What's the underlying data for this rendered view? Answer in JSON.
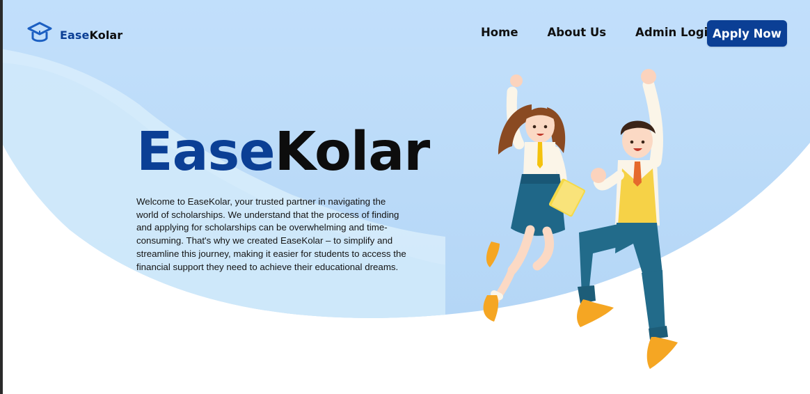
{
  "nav": {
    "logo_prefix": "Ease",
    "logo_suffix": "Kolar",
    "links": [
      {
        "label": "Home"
      },
      {
        "label": "About Us"
      },
      {
        "label": "Admin Login"
      }
    ],
    "cta_label": "Apply Now"
  },
  "hero": {
    "title_prefix": "Ease",
    "title_suffix": "Kolar",
    "description": "Welcome to EaseKolar, your trusted partner in navigating the world of scholarships. We understand that the process of finding and applying for scholarships can be overwhelming and time-consuming. That's why we created EaseKolar – to simplify and streamline this journey, making it easier for students to access the financial support they need to achieve their educational dreams."
  },
  "icons": {
    "logo": "graduation-cap-icon"
  },
  "colors": {
    "brand": "#0b3f95",
    "sky": "#c7e2fb",
    "text": "#0d0d0d"
  }
}
